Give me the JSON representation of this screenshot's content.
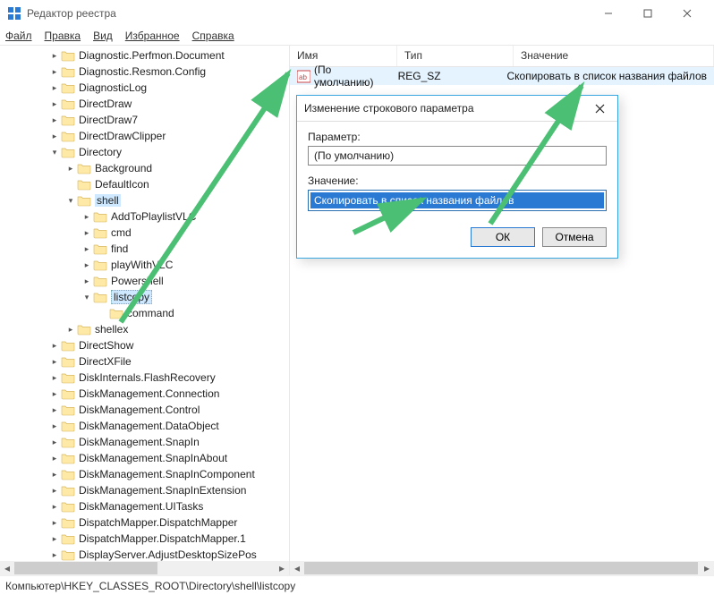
{
  "window": {
    "title": "Редактор реестра"
  },
  "menu": {
    "file": "Файл",
    "edit": "Правка",
    "view": "Вид",
    "favorites": "Избранное",
    "help": "Справка"
  },
  "tree": {
    "items": [
      {
        "indent": 2,
        "expander": "right",
        "label": "Diagnostic.Perfmon.Document"
      },
      {
        "indent": 2,
        "expander": "right",
        "label": "Diagnostic.Resmon.Config"
      },
      {
        "indent": 2,
        "expander": "right",
        "label": "DiagnosticLog"
      },
      {
        "indent": 2,
        "expander": "right",
        "label": "DirectDraw"
      },
      {
        "indent": 2,
        "expander": "right",
        "label": "DirectDraw7"
      },
      {
        "indent": 2,
        "expander": "right",
        "label": "DirectDrawClipper"
      },
      {
        "indent": 2,
        "expander": "down",
        "label": "Directory"
      },
      {
        "indent": 3,
        "expander": "right",
        "label": "Background"
      },
      {
        "indent": 3,
        "expander": "none",
        "label": "DefaultIcon"
      },
      {
        "indent": 3,
        "expander": "down",
        "label": "shell",
        "selectedBg": true
      },
      {
        "indent": 4,
        "expander": "right",
        "label": "AddToPlaylistVLC"
      },
      {
        "indent": 4,
        "expander": "right",
        "label": "cmd"
      },
      {
        "indent": 4,
        "expander": "right",
        "label": "find"
      },
      {
        "indent": 4,
        "expander": "right",
        "label": "playWithVLC"
      },
      {
        "indent": 4,
        "expander": "right",
        "label": "Powershell"
      },
      {
        "indent": 4,
        "expander": "down",
        "label": "listcopy",
        "selected": true
      },
      {
        "indent": 5,
        "expander": "none",
        "label": "command"
      },
      {
        "indent": 3,
        "expander": "right",
        "label": "shellex"
      },
      {
        "indent": 2,
        "expander": "right",
        "label": "DirectShow"
      },
      {
        "indent": 2,
        "expander": "right",
        "label": "DirectXFile"
      },
      {
        "indent": 2,
        "expander": "right",
        "label": "DiskInternals.FlashRecovery"
      },
      {
        "indent": 2,
        "expander": "right",
        "label": "DiskManagement.Connection"
      },
      {
        "indent": 2,
        "expander": "right",
        "label": "DiskManagement.Control"
      },
      {
        "indent": 2,
        "expander": "right",
        "label": "DiskManagement.DataObject"
      },
      {
        "indent": 2,
        "expander": "right",
        "label": "DiskManagement.SnapIn"
      },
      {
        "indent": 2,
        "expander": "right",
        "label": "DiskManagement.SnapInAbout"
      },
      {
        "indent": 2,
        "expander": "right",
        "label": "DiskManagement.SnapInComponent"
      },
      {
        "indent": 2,
        "expander": "right",
        "label": "DiskManagement.SnapInExtension"
      },
      {
        "indent": 2,
        "expander": "right",
        "label": "DiskManagement.UITasks"
      },
      {
        "indent": 2,
        "expander": "right",
        "label": "DispatchMapper.DispatchMapper"
      },
      {
        "indent": 2,
        "expander": "right",
        "label": "DispatchMapper.DispatchMapper.1"
      },
      {
        "indent": 2,
        "expander": "right",
        "label": "DisplayServer.AdjustDesktopSizePos"
      }
    ]
  },
  "list": {
    "headers": {
      "name": "Имя",
      "type": "Тип",
      "value": "Значение"
    },
    "rows": [
      {
        "name": "(По умолчанию)",
        "type": "REG_SZ",
        "value": "Скопировать в список названия файлов"
      }
    ]
  },
  "dialog": {
    "title": "Изменение строкового параметра",
    "paramLabel": "Параметр:",
    "paramValue": "(По умолчанию)",
    "valueLabel": "Значение:",
    "valueInput": "Скопировать в список названия файлов",
    "ok": "ОК",
    "cancel": "Отмена"
  },
  "statusbar": {
    "path": "Компьютер\\HKEY_CLASSES_ROOT\\Directory\\shell\\listcopy"
  }
}
